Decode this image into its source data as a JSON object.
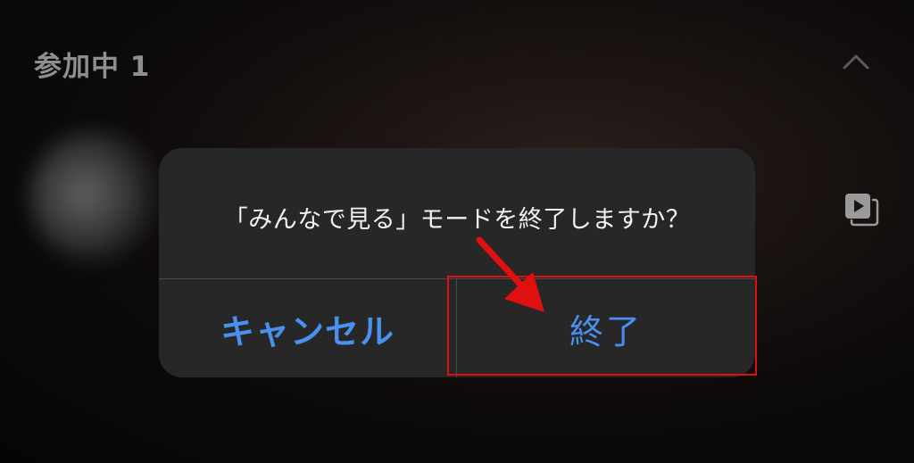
{
  "header": {
    "title": "参加中 1"
  },
  "dialog": {
    "message": "「みんなで見る」モードを終了しますか？",
    "cancel_label": "キャンセル",
    "end_label": "終了"
  },
  "colors": {
    "accent": "#4a90f0",
    "dialog_background": "#272727",
    "annotation_red": "#e01010"
  },
  "icons": {
    "collapse": "chevron-up-icon",
    "media": "media-player-icon"
  }
}
